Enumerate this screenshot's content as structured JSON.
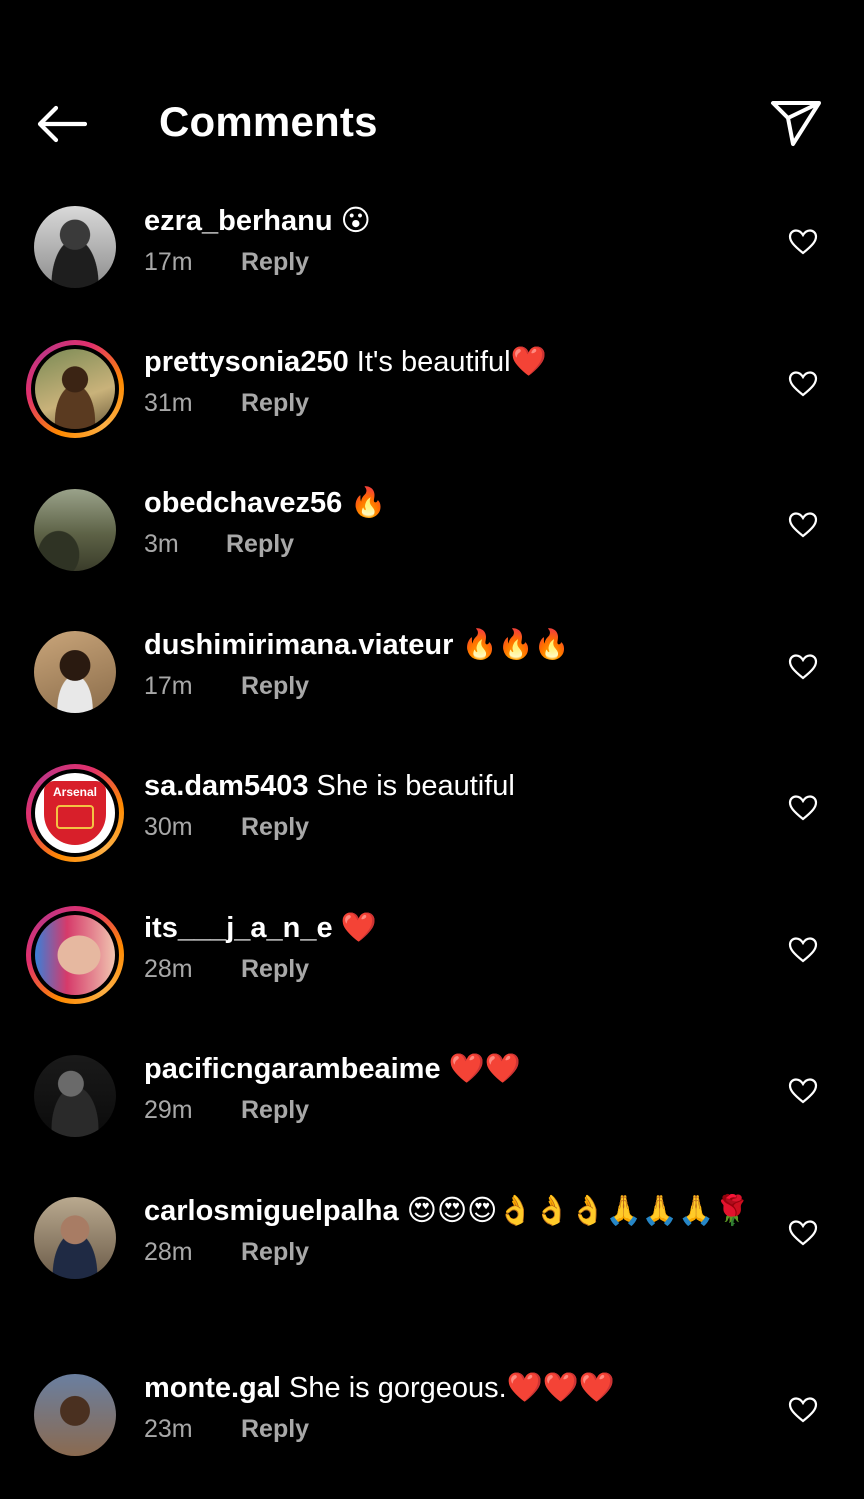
{
  "header": {
    "title": "Comments"
  },
  "comments": [
    {
      "username": "ezra_berhanu",
      "text": "😮",
      "time": "17m",
      "reply": "Reply"
    },
    {
      "username": "prettysonia250",
      "text": "It's beautiful❤️",
      "time": "31m",
      "reply": "Reply"
    },
    {
      "username": "obedchavez56",
      "text": "🔥",
      "time": "3m",
      "reply": "Reply"
    },
    {
      "username": "dushimirimana.viateur",
      "text": "🔥🔥🔥",
      "time": "17m",
      "reply": "Reply"
    },
    {
      "username": "sa.dam5403",
      "text": "She is beautiful",
      "time": "30m",
      "reply": "Reply",
      "avatar_text": "Arsenal"
    },
    {
      "username": "its___j_a_n_e",
      "text": "❤️",
      "time": "28m",
      "reply": "Reply"
    },
    {
      "username": "pacificngarambeaime",
      "text": "❤️❤️",
      "time": "29m",
      "reply": "Reply"
    },
    {
      "username": "carlosmiguelpalha",
      "text": "😍😍😍👌👌👌🙏🙏🙏🌹",
      "time": "28m",
      "reply": "Reply"
    },
    {
      "username": "monte.gal",
      "text": "She is gorgeous.❤️❤️❤️",
      "time": "23m",
      "reply": "Reply"
    }
  ],
  "colors": {
    "background": "#000000",
    "text": "#ffffff",
    "secondary_text": "#a8a8a8",
    "story_ring_start": "#ff8a00",
    "story_ring_end": "#c13584"
  }
}
